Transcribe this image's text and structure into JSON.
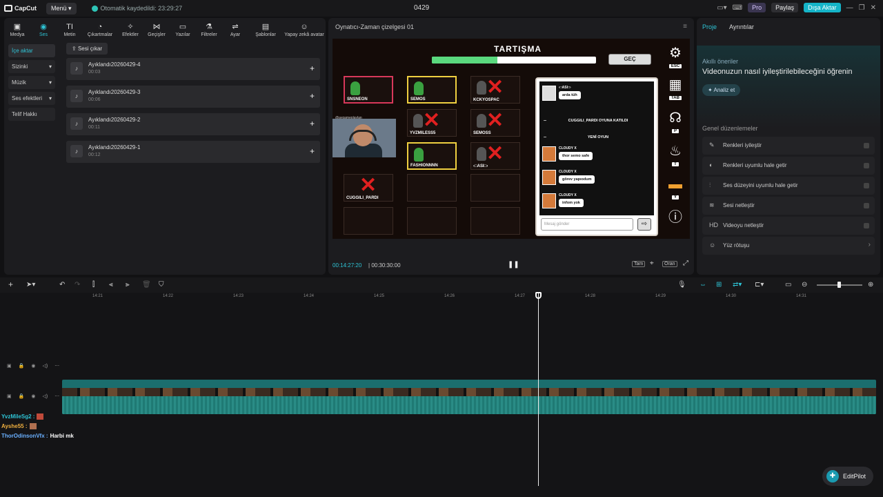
{
  "topbar": {
    "logo": "CapCut",
    "menu": "Menü",
    "autosave": "Otomatik kaydedildi: 23:29:27",
    "project": "0429",
    "pro": "Pro",
    "share": "Paylaş",
    "export": "Dışa Aktar"
  },
  "tools": [
    "Medya",
    "Ses",
    "Metin",
    "Çıkartmalar",
    "Efektler",
    "Geçişler",
    "Yazılar",
    "Filtreler",
    "Ayar",
    "Şablonlar",
    "Yapay zekâ avatar"
  ],
  "nav": {
    "import": "İçe aktar",
    "yours": "Sizinki",
    "music": "Müzik",
    "sfx": "Ses efektleri",
    "copyright": "Telif Hakkı"
  },
  "media": {
    "remove_vocals": "Sesi çıkar",
    "items": [
      {
        "name": "Ayıklandı20260429-4",
        "dur": "00:03"
      },
      {
        "name": "Ayıklandı20260429-3",
        "dur": "00:06"
      },
      {
        "name": "Ayıklandı20260429-2",
        "dur": "00:11"
      },
      {
        "name": "Ayıklandı20260429-1",
        "dur": "00:12"
      }
    ]
  },
  "player": {
    "title": "Oynatıcı-Zaman çizelgesi 01",
    "time": "00:14:27:20",
    "total": "00:30:30:00",
    "full": "Tam",
    "ratio": "Oran"
  },
  "game": {
    "title": "TARTIŞMA",
    "progress": 0.4,
    "skip": "GEÇ",
    "players": [
      "SNSNEON",
      "SEMOS",
      "KCKYOSPAC",
      "YVZMILESS5",
      "SEMOSS",
      "FASHIONNNN",
      "‹□ASI□›",
      "CUGGILI_PARDI"
    ],
    "cam_label": "@aygameplaylan",
    "chat": [
      {
        "user": "‹□ASI□›",
        "text": "arda tüh"
      },
      {
        "system": "CUGGILI_PARDI OYUNA KATILDI"
      },
      {
        "system": "YENİ OYUN"
      },
      {
        "user": "CLOUDY X",
        "text": "thor semo safe"
      },
      {
        "user": "CLOUDY X",
        "text": "görev yapıodum"
      },
      {
        "user": "CLOUDY X",
        "text": "infom yok"
      }
    ],
    "chat_placeholder": "Mesaj gönder",
    "keys": [
      "ESC",
      "TAB",
      "P",
      "T",
      "Y"
    ]
  },
  "right": {
    "tab_project": "Proje",
    "tab_details": "Ayrıntılar",
    "smart_title": "Akıllı öneriler",
    "smart_text": "Videonuzun nasıl iyileştirilebileceğini öğrenin",
    "analyze": "Analiz et",
    "general": "Genel düzenlemeler",
    "edits": [
      "Renkleri iyileştir",
      "Renkleri uyumlu hale getir",
      "Ses düzeyini uyumlu hale getir",
      "Sesi netleştir",
      "Videoyu netleştir",
      "Yüz rötuşu"
    ]
  },
  "ruler": [
    "14:21",
    "14:22",
    "14:23",
    "14:24",
    "14:25",
    "14:26",
    "14:27",
    "14:28",
    "14:29",
    "14:30",
    "14:31"
  ],
  "overlay_chat": [
    {
      "user": "YvzMileSg2 :",
      "text": ""
    },
    {
      "user": "Ayshe55 :",
      "text": ""
    },
    {
      "user": "ThorOdinsonVfx :",
      "text": "Harbi mk"
    }
  ],
  "editpilot": "EditPilot"
}
